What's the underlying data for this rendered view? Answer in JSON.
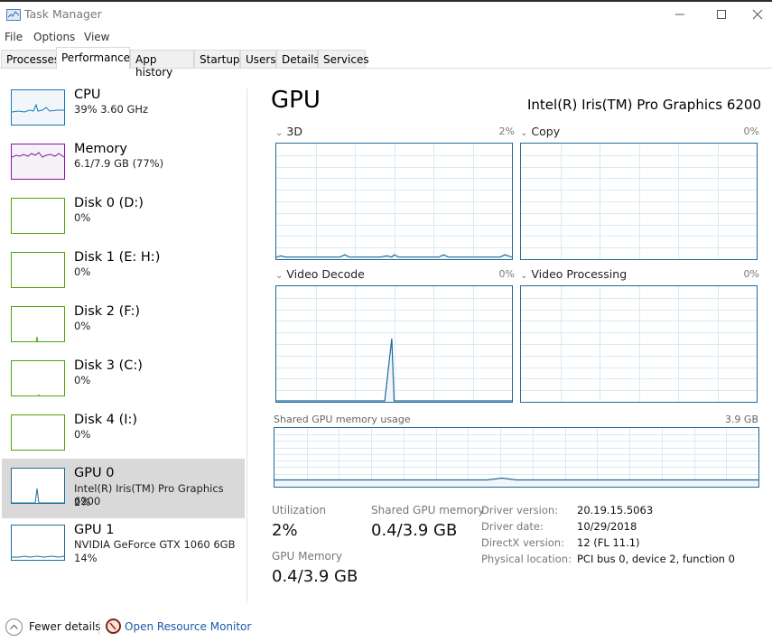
{
  "window": {
    "title": "Task Manager",
    "controls": [
      "minimize",
      "maximize",
      "close"
    ]
  },
  "menu": [
    "File",
    "Options",
    "View"
  ],
  "tabs": [
    {
      "label": "Processes",
      "active": false
    },
    {
      "label": "Performance",
      "active": true
    },
    {
      "label": "App history",
      "active": false
    },
    {
      "label": "Startup",
      "active": false
    },
    {
      "label": "Users",
      "active": false
    },
    {
      "label": "Details",
      "active": false
    },
    {
      "label": "Services",
      "active": false
    }
  ],
  "sidebar": [
    {
      "name": "CPU",
      "sub1": "39% 3.60 GHz",
      "sub2": "",
      "color": "#1779ba",
      "fill": "#f1f6fa"
    },
    {
      "name": "Memory",
      "sub1": "6.1/7.9 GB (77%)",
      "sub2": "",
      "color": "#8b12ae",
      "fill": "#f4f2f4"
    },
    {
      "name": "Disk 0 (D:)",
      "sub1": "0%",
      "sub2": "",
      "color": "#4da60c",
      "fill": "#ffffff"
    },
    {
      "name": "Disk 1 (E: H:)",
      "sub1": "0%",
      "sub2": "",
      "color": "#4da60c",
      "fill": "#ffffff"
    },
    {
      "name": "Disk 2 (F:)",
      "sub1": "0%",
      "sub2": "",
      "color": "#4da60c",
      "fill": "#ffffff"
    },
    {
      "name": "Disk 3 (C:)",
      "sub1": "0%",
      "sub2": "",
      "color": "#4da60c",
      "fill": "#ffffff"
    },
    {
      "name": "Disk 4 (I:)",
      "sub1": "0%",
      "sub2": "",
      "color": "#4da60c",
      "fill": "#ffffff"
    },
    {
      "name": "GPU 0",
      "sub1": "Intel(R) Iris(TM) Pro Graphics 6200",
      "sub2": "2%",
      "color": "#1f6b99",
      "fill": "#ffffff",
      "selected": true
    },
    {
      "name": "GPU 1",
      "sub1": "NVIDIA GeForce GTX 1060 6GB",
      "sub2": "14%",
      "color": "#1f6b99",
      "fill": "#ffffff"
    }
  ],
  "main": {
    "title": "GPU",
    "device": "Intel(R) Iris(TM) Pro Graphics 6200",
    "engines": [
      {
        "label": "3D",
        "percent": "2%"
      },
      {
        "label": "Copy",
        "percent": "0%"
      },
      {
        "label": "Video Decode",
        "percent": "0%"
      },
      {
        "label": "Video Processing",
        "percent": "0%"
      }
    ],
    "shared_memory_chart": {
      "label": "Shared GPU memory usage",
      "max": "3.9 GB"
    },
    "stats": {
      "utilization_label": "Utilization",
      "utilization_value": "2%",
      "shared_label": "Shared GPU memory",
      "shared_value": "0.4/3.9 GB",
      "gpu_memory_label": "GPU Memory",
      "gpu_memory_value": "0.4/3.9 GB"
    },
    "details": [
      {
        "key": "Driver version:",
        "value": "20.19.15.5063"
      },
      {
        "key": "Driver date:",
        "value": "10/29/2018"
      },
      {
        "key": "DirectX version:",
        "value": "12 (FL 11.1)"
      },
      {
        "key": "Physical location:",
        "value": "PCI bus 0, device 2, function 0"
      }
    ]
  },
  "footer": {
    "fewer_details": "Fewer details",
    "resource_monitor": "Open Resource Monitor"
  },
  "colors": {
    "gpu_line": "#1f6b99",
    "gpu_fill": "#f1f6fa",
    "grid": "#d9eaf4",
    "link": "#1a5aa8"
  }
}
